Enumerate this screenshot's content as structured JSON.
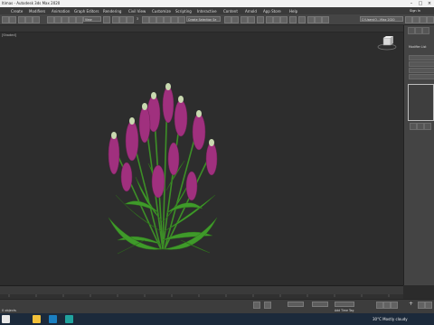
{
  "window": {
    "title": "ltimas - Autodesk 3ds Max 2020",
    "sign_in": "Sign In",
    "workspace": "C:\\Users\\O...\\Max 2020"
  },
  "menu": [
    "Create",
    "Modifiers",
    "Animation",
    "Graph Editors",
    "Rendering",
    "Civil View",
    "Customize",
    "Scripting",
    "Interactive",
    "Content",
    "Arnold",
    "App Store",
    "Help"
  ],
  "toolbar": {
    "view_dropdown": "View",
    "selection_set": "Create Selection Se"
  },
  "viewport": {
    "label": "[Shaded]"
  },
  "command_panel": {
    "modifier_list": "Modifier List"
  },
  "status": {
    "message": "0 objects",
    "add_time_tag": "Add Time Tag"
  },
  "taskbar": {
    "weather": "30°C  Mostly cloudy"
  },
  "colors": {
    "flower": "#a0307e",
    "leaf": "#3d8f27",
    "viewport_bg": "#2d2d2d"
  }
}
